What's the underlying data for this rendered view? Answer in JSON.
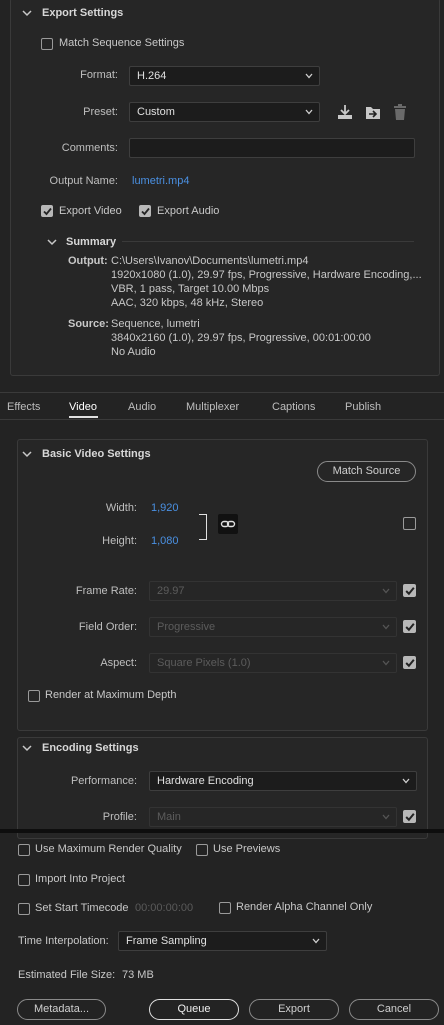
{
  "export_settings": {
    "title": "Export Settings",
    "match_sequence_label": "Match Sequence Settings",
    "format_label": "Format:",
    "format_value": "H.264",
    "preset_label": "Preset:",
    "preset_value": "Custom",
    "comments_label": "Comments:",
    "comments_value": "",
    "output_name_label": "Output Name:",
    "output_name_value": "lumetri.mp4",
    "export_video_label": "Export Video",
    "export_audio_label": "Export Audio",
    "export_video_checked": true,
    "export_audio_checked": true
  },
  "summary": {
    "title": "Summary",
    "output_label": "Output:",
    "output_lines": [
      "C:\\Users\\Ivanov\\Documents\\lumetri.mp4",
      "1920x1080 (1.0), 29.97 fps, Progressive, Hardware Encoding,...",
      "VBR, 1 pass, Target 10.00 Mbps",
      "AAC, 320 kbps, 48 kHz, Stereo"
    ],
    "source_label": "Source:",
    "source_lines": [
      "Sequence, lumetri",
      "3840x2160 (1.0), 29.97 fps, Progressive, 00:01:00:00",
      "No Audio"
    ]
  },
  "tabs": [
    {
      "label": "Effects",
      "active": false
    },
    {
      "label": "Video",
      "active": true
    },
    {
      "label": "Audio",
      "active": false
    },
    {
      "label": "Multiplexer",
      "active": false
    },
    {
      "label": "Captions",
      "active": false
    },
    {
      "label": "Publish",
      "active": false
    }
  ],
  "basic_video": {
    "title": "Basic Video Settings",
    "match_source_label": "Match Source",
    "width_label": "Width:",
    "width_value": "1,920",
    "height_label": "Height:",
    "height_value": "1,080",
    "frame_rate_label": "Frame Rate:",
    "frame_rate_value": "29.97",
    "field_order_label": "Field Order:",
    "field_order_value": "Progressive",
    "aspect_label": "Aspect:",
    "aspect_value": "Square Pixels (1.0)",
    "render_max_depth_label": "Render at Maximum Depth"
  },
  "encoding": {
    "title": "Encoding Settings",
    "performance_label": "Performance:",
    "performance_value": "Hardware Encoding",
    "profile_label": "Profile:",
    "profile_value": "Main"
  },
  "bottom": {
    "max_render_quality_label": "Use Maximum Render Quality",
    "use_previews_label": "Use Previews",
    "import_into_project_label": "Import Into Project",
    "set_start_timecode_label": "Set Start Timecode",
    "start_timecode_value": "00:00:00:00",
    "render_alpha_label": "Render Alpha Channel Only",
    "time_interpolation_label": "Time Interpolation:",
    "time_interpolation_value": "Frame Sampling",
    "estimated_size_label": "Estimated File Size:",
    "estimated_size_value": "73 MB",
    "metadata_button": "Metadata...",
    "queue_button": "Queue",
    "export_button": "Export",
    "cancel_button": "Cancel"
  },
  "colors": {
    "accent_blue": "#4a90e2",
    "background": "#232323"
  }
}
